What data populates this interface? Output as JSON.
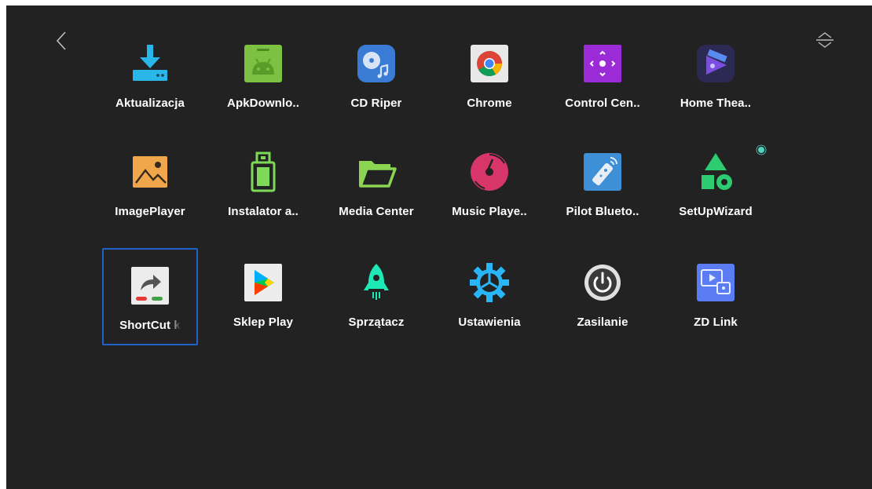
{
  "screen": {
    "background": "#222222",
    "focus_color": "#1f63c9",
    "accent_dot_color": "#4fd4c2"
  },
  "nav": {
    "back_icon": "chevron-left-icon",
    "sort_icon": "sort-up-down-icon"
  },
  "apps": [
    {
      "label": "Aktualizacja",
      "icon": "download-update-icon"
    },
    {
      "label": "ApkDownlo..",
      "icon": "android-icon"
    },
    {
      "label": "CD Riper",
      "icon": "cd-music-icon"
    },
    {
      "label": "Chrome",
      "icon": "chrome-icon"
    },
    {
      "label": "Control Cen..",
      "icon": "remote-dpad-icon"
    },
    {
      "label": "Home Thea..",
      "icon": "film-play-icon"
    },
    {
      "label": "ImagePlayer",
      "icon": "image-icon"
    },
    {
      "label": "Instalator a..",
      "icon": "usb-drive-icon"
    },
    {
      "label": "Media Center",
      "icon": "folder-icon"
    },
    {
      "label": "Music Playe..",
      "icon": "vinyl-disc-icon"
    },
    {
      "label": "Pilot Blueto..",
      "icon": "bluetooth-remote-icon"
    },
    {
      "label": "SetUpWizard",
      "icon": "shapes-icon"
    },
    {
      "label": "ShortCut k",
      "icon": "shortcut-arrow-icon",
      "focused": true
    },
    {
      "label": "Sklep Play",
      "icon": "play-store-icon"
    },
    {
      "label": "Sprzątacz",
      "icon": "rocket-cleaner-icon"
    },
    {
      "label": "Ustawienia",
      "icon": "gear-icon"
    },
    {
      "label": "Zasilanie",
      "icon": "power-icon"
    },
    {
      "label": "ZD Link",
      "icon": "screen-cast-icon"
    }
  ]
}
